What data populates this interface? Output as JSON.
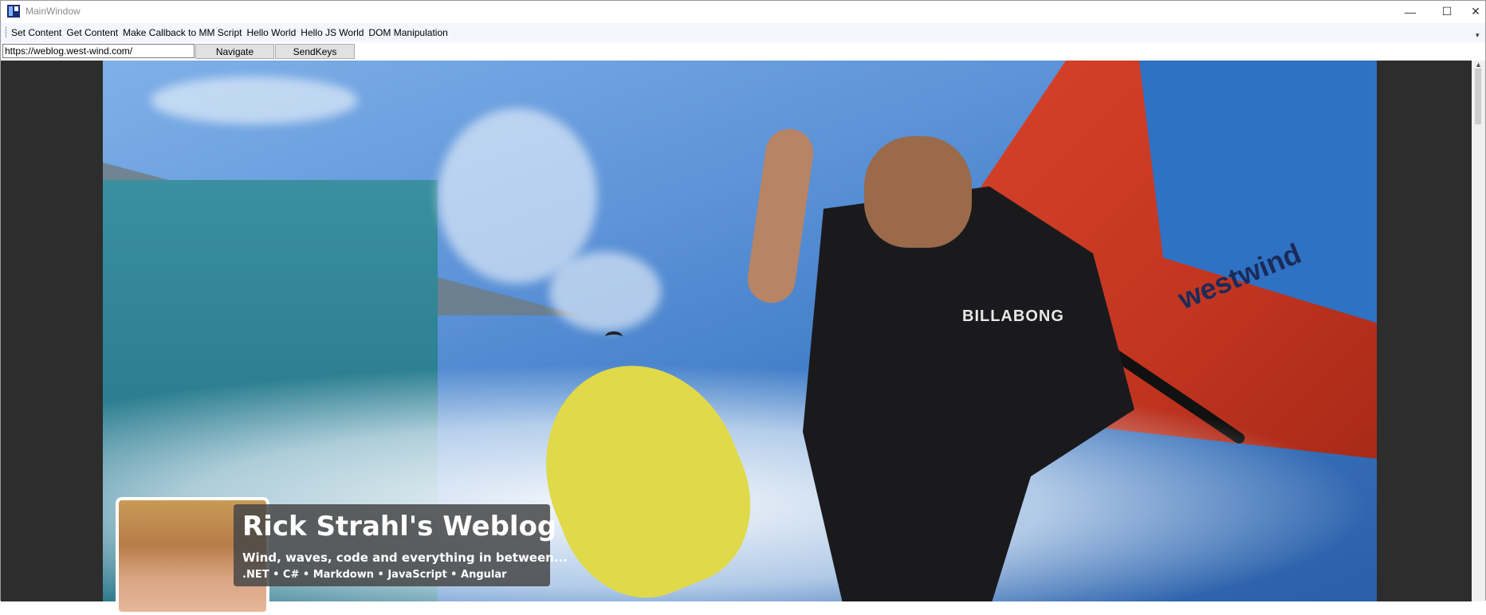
{
  "window": {
    "title": "MainWindow",
    "minimize_glyph": "—",
    "maximize_glyph": "☐",
    "close_glyph": "✕"
  },
  "menu": {
    "items": [
      {
        "label": "Set Content"
      },
      {
        "label": "Get Content"
      },
      {
        "label": "Make Callback to MM Script"
      },
      {
        "label": "Hello World"
      },
      {
        "label": "Hello JS World"
      },
      {
        "label": "DOM Manipulation"
      }
    ],
    "overflow_glyph": "▾"
  },
  "toolbar": {
    "url_value": "https://weblog.west-wind.com/",
    "navigate_label": "Navigate",
    "sendkeys_label": "SendKeys"
  },
  "page": {
    "blog_title": "Rick Strahl's Weblog",
    "subtitle": "Wind, waves, code and everything in between...",
    "tags": ".NET • C# • Markdown • JavaScript • Angular",
    "sail_brand": "westwind",
    "wetsuit_brand": "BILLABONG"
  },
  "scrollbar": {
    "up_arrow": "▲"
  }
}
